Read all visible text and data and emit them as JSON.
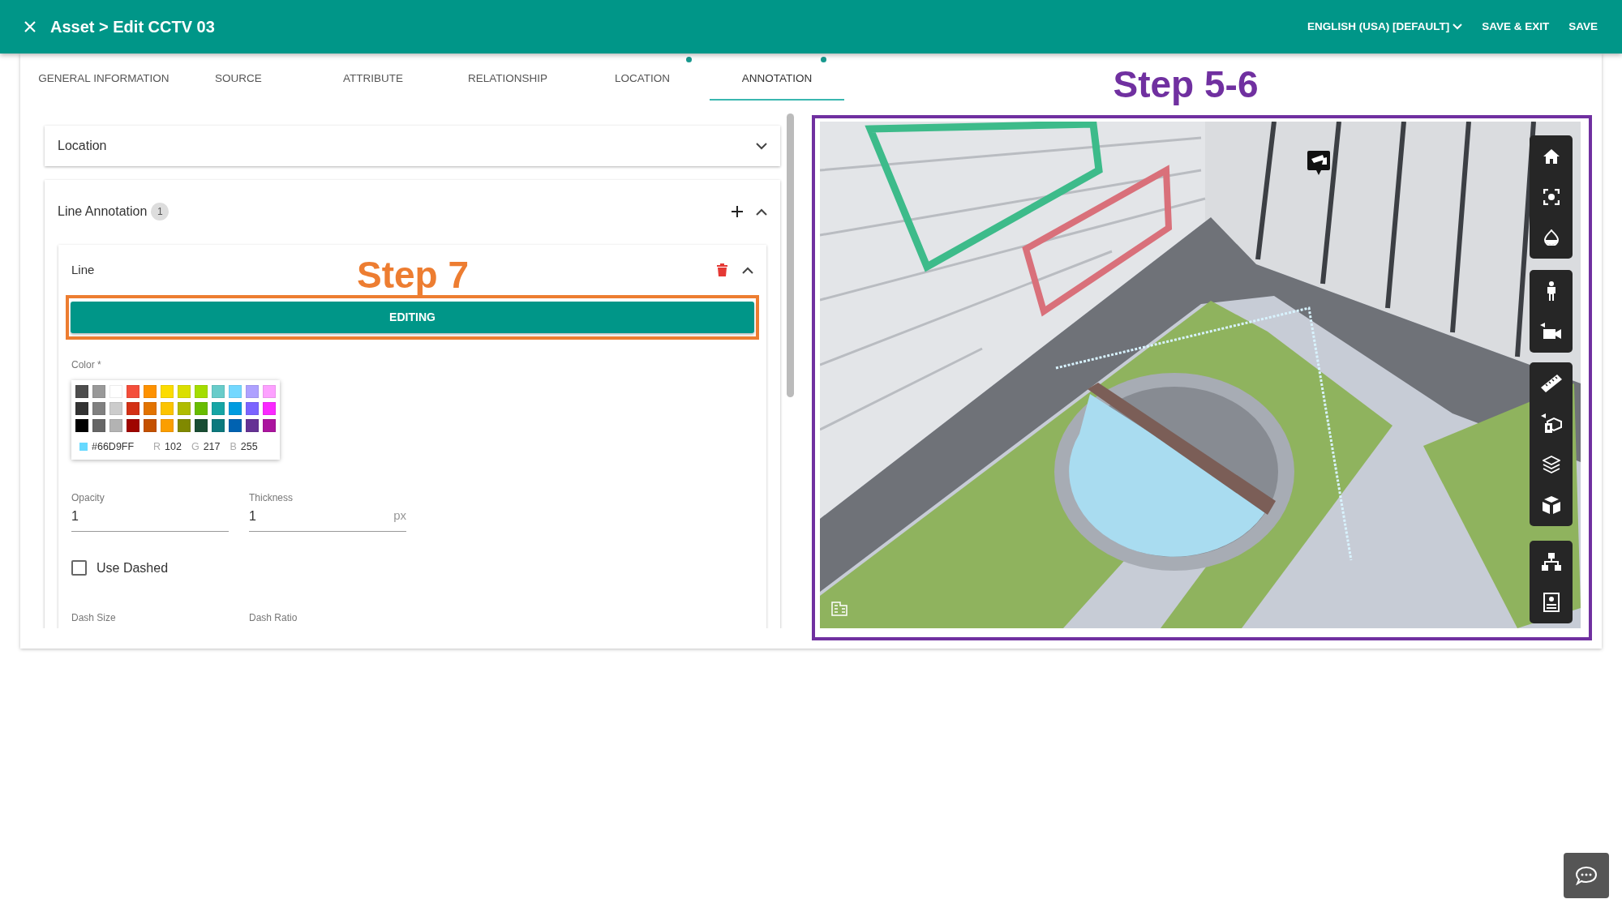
{
  "header": {
    "title": "Asset > Edit CCTV 03",
    "language": "ENGLISH (USA) [DEFAULT]",
    "actions": [
      "SAVE & EXIT",
      "SAVE"
    ]
  },
  "tabs": [
    {
      "label": "GENERAL INFORMATION",
      "selected": false,
      "dot": false
    },
    {
      "label": "SOURCE",
      "selected": false,
      "dot": false
    },
    {
      "label": "ATTRIBUTE",
      "selected": false,
      "dot": false
    },
    {
      "label": "RELATIONSHIP",
      "selected": false,
      "dot": false
    },
    {
      "label": "LOCATION",
      "selected": false,
      "dot": true
    },
    {
      "label": "ANNOTATION",
      "selected": true,
      "dot": true
    }
  ],
  "step_labels": [
    {
      "text": "Step 5-6",
      "color": "#7030a0"
    },
    {
      "text": "Step 7",
      "color": "#ed7d31"
    }
  ],
  "location_section": {
    "title": "Location",
    "expanded": false
  },
  "line_annotation": {
    "title": "Line Annotation",
    "count": "1",
    "expanded": true,
    "line": {
      "title": "Line",
      "expanded": true,
      "edit_button": "EDITING",
      "color_label": "Color *",
      "swatches": [
        {
          "color": "#4d4d4d"
        },
        {
          "color": "#999999"
        },
        {
          "color": "#ffffff"
        },
        {
          "color": "#f44e3b"
        },
        {
          "color": "#fe9200"
        },
        {
          "color": "#fcdc00"
        },
        {
          "color": "#dbdf00"
        },
        {
          "color": "#a4dd00"
        },
        {
          "color": "#68ccca"
        },
        {
          "color": "#73d8ff"
        },
        {
          "color": "#aea1ff"
        },
        {
          "color": "#fda1ff"
        },
        {
          "color": "#333333"
        },
        {
          "color": "#808080"
        },
        {
          "color": "#cccccc"
        },
        {
          "color": "#d33115"
        },
        {
          "color": "#e27300"
        },
        {
          "color": "#fcc400"
        },
        {
          "color": "#b0bc00"
        },
        {
          "color": "#68bc00"
        },
        {
          "color": "#16a5a5"
        },
        {
          "color": "#009ce0"
        },
        {
          "color": "#7b64ff"
        },
        {
          "color": "#fa28ff"
        },
        {
          "color": "#000000"
        },
        {
          "color": "#666666"
        },
        {
          "color": "#b3b3b3"
        },
        {
          "color": "#9f0500"
        },
        {
          "color": "#c45100"
        },
        {
          "color": "#fb9e00"
        },
        {
          "color": "#808900"
        },
        {
          "color": "#194d33"
        },
        {
          "color": "#0c797d"
        },
        {
          "color": "#0062b1"
        },
        {
          "color": "#653294"
        },
        {
          "color": "#ab149e"
        }
      ],
      "picker": {
        "color": "#66d9ff",
        "hex": "#66D9FF",
        "channels": [
          {
            "label": "R",
            "value": "102"
          },
          {
            "label": "G",
            "value": "217"
          },
          {
            "label": "B",
            "value": "255"
          }
        ]
      },
      "fields": [
        {
          "label": "Opacity",
          "value": "1"
        },
        {
          "label": "Thickness",
          "value": "1",
          "suffix": "px"
        }
      ],
      "use_dashed": {
        "label": "Use Dashed",
        "checked": false
      },
      "dash_fields": [
        {
          "label": "Dash Size"
        },
        {
          "label": "Dash Ratio"
        }
      ]
    }
  }
}
